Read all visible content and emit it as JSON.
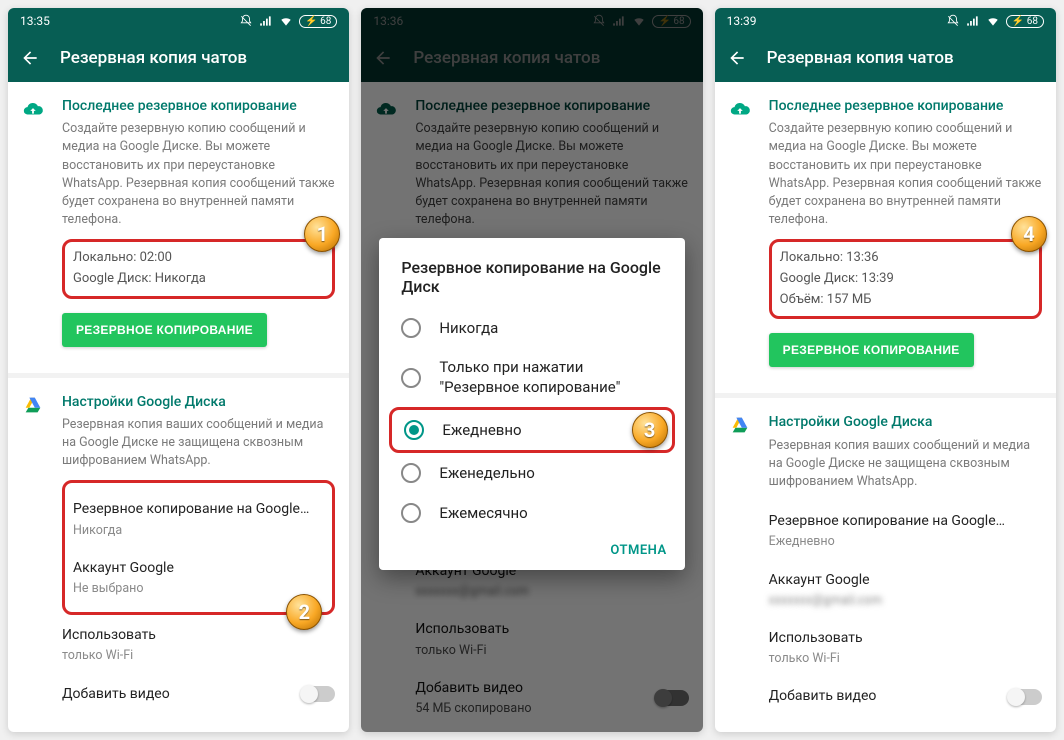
{
  "screens": [
    {
      "time": "13:35",
      "title": "Резервная копия чатов",
      "section1_title": "Последнее резервное копирование",
      "desc": "Создайте резервную копию сообщений и медиа на Google Диске. Вы можете восстановить их при переустановке WhatsApp. Резервная копия сообщений также будет сохранена во внутренней памяти телефона.",
      "info_local": "Локально: 02:00",
      "info_gdrive": "Google Диск: Никогда",
      "backup_btn": "РЕЗЕРВНОЕ КОПИРОВАНИЕ",
      "section2_title": "Настройки Google Диска",
      "section2_desc": "Резервная копия ваших сообщений и медиа на Google Диске не защищена сквозным шифрованием WhatsApp.",
      "backup_to_label": "Резервное копирование на Google…",
      "backup_to_value": "Никогда",
      "account_label": "Аккаунт Google",
      "account_value": "Не выбрано",
      "use_label": "Использовать",
      "use_value": "только Wi-Fi",
      "video_label": "Добавить видео"
    },
    {
      "time": "13:36",
      "title": "Резервная копия чатов",
      "section1_title": "Последнее резервное копирование",
      "desc": "Создайте резервную копию сообщений и медиа на Google Диске. Вы можете восстановить их при переустановке WhatsApp. Резервная копия сообщений также будет сохранена во внутренней памяти телефона.",
      "dialog_title": "Резервное копирование на Google Диск",
      "options": [
        "Никогда",
        "Только при нажатии \"Резервное копирование\"",
        "Ежедневно",
        "Еженедельно",
        "Ежемесячно"
      ],
      "selected_option": 2,
      "cancel": "ОТМЕНА",
      "account_label": "Аккаунт Google",
      "account_value_blur": "xxxxxxx@gmail.com",
      "use_label": "Использовать",
      "use_value": "только Wi-Fi",
      "video_label": "Добавить видео",
      "video_sub": "54 МБ скопировано"
    },
    {
      "time": "13:39",
      "title": "Резервная копия чатов",
      "section1_title": "Последнее резервное копирование",
      "desc": "Создайте резервную копию сообщений и медиа на Google Диске. Вы можете восстановить их при переустановке WhatsApp. Резервная копия сообщений также будет сохранена во внутренней памяти телефона.",
      "info_local": "Локально: 13:36",
      "info_gdrive": "Google Диск: 13:39",
      "info_size": "Объём: 157 МБ",
      "backup_btn": "РЕЗЕРВНОЕ КОПИРОВАНИЕ",
      "section2_title": "Настройки Google Диска",
      "section2_desc": "Резервная копия ваших сообщений и медиа на Google Диске не защищена сквозным шифрованием WhatsApp.",
      "backup_to_label": "Резервное копирование на Google…",
      "backup_to_value": "Ежедневно",
      "account_label": "Аккаунт Google",
      "account_value_blur": "xxxxxxx@gmail.com",
      "use_label": "Использовать",
      "use_value": "только Wi-Fi",
      "video_label": "Добавить видео"
    }
  ],
  "battery": "68",
  "callouts": [
    "1",
    "2",
    "3",
    "4"
  ]
}
